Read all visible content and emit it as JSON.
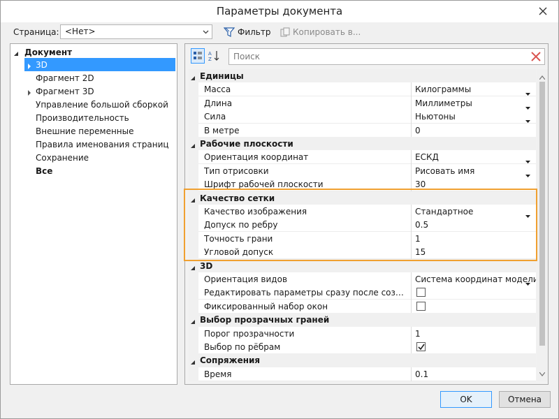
{
  "window": {
    "title": "Параметры документа"
  },
  "toolbar": {
    "page_label": "Страница:",
    "page_value": "<Нет>",
    "filter_label": "Фильтр",
    "copy_label": "Копировать в..."
  },
  "tree": {
    "root": "Документ",
    "items": [
      {
        "label": "3D",
        "selected": true,
        "expandable": true,
        "bold": false
      },
      {
        "label": "Фрагмент 2D",
        "selected": false,
        "expandable": false,
        "bold": false
      },
      {
        "label": "Фрагмент 3D",
        "selected": false,
        "expandable": true,
        "bold": false
      },
      {
        "label": "Управление большой сборкой",
        "selected": false,
        "expandable": false,
        "bold": false
      },
      {
        "label": "Производительность",
        "selected": false,
        "expandable": false,
        "bold": false
      },
      {
        "label": "Внешние переменные",
        "selected": false,
        "expandable": false,
        "bold": false
      },
      {
        "label": "Правила именования страниц",
        "selected": false,
        "expandable": false,
        "bold": false
      },
      {
        "label": "Сохранение",
        "selected": false,
        "expandable": false,
        "bold": false
      },
      {
        "label": "Все",
        "selected": false,
        "expandable": false,
        "bold": true
      }
    ]
  },
  "search": {
    "placeholder": "Поиск"
  },
  "grid": {
    "categories": [
      {
        "label": "Единицы",
        "rows": [
          {
            "name": "Масса",
            "value": "Килограммы",
            "type": "dropdown"
          },
          {
            "name": "Длина",
            "value": "Миллиметры",
            "type": "dropdown"
          },
          {
            "name": "Сила",
            "value": "Ньютоны",
            "type": "dropdown"
          },
          {
            "name": "В метре",
            "value": "0",
            "type": "text"
          }
        ]
      },
      {
        "label": "Рабочие плоскости",
        "rows": [
          {
            "name": "Ориентация координат",
            "value": "ЕСКД",
            "type": "dropdown"
          },
          {
            "name": "Тип отрисовки",
            "value": "Рисовать имя",
            "type": "dropdown"
          },
          {
            "name": "Шрифт рабочей плоскости",
            "value": "30",
            "type": "text"
          }
        ]
      },
      {
        "label": "Качество сетки",
        "rows": [
          {
            "name": "Качество изображения",
            "value": "Стандартное",
            "type": "dropdown"
          },
          {
            "name": "Допуск по ребру",
            "value": "0.5",
            "type": "text"
          },
          {
            "name": "Точность грани",
            "value": "1",
            "type": "text"
          },
          {
            "name": "Угловой допуск",
            "value": "15",
            "type": "text"
          }
        ]
      },
      {
        "label": "3D",
        "rows": [
          {
            "name": "Ориентация видов",
            "value": "Система координат модели",
            "type": "dropdown"
          },
          {
            "name": "Редактировать параметры сразу после создания (т...",
            "value": "",
            "type": "checkbox",
            "checked": false
          },
          {
            "name": "Фиксированный набор окон",
            "value": "",
            "type": "checkbox",
            "checked": false
          }
        ]
      },
      {
        "label": "Выбор прозрачных граней",
        "rows": [
          {
            "name": "Порог прозрачности",
            "value": "1",
            "type": "text"
          },
          {
            "name": "Выбор по рёбрам",
            "value": "",
            "type": "checkbox",
            "checked": true
          }
        ]
      },
      {
        "label": "Сопряжения",
        "rows": [
          {
            "name": "Время",
            "value": "0.1",
            "type": "text"
          }
        ]
      }
    ]
  },
  "buttons": {
    "ok": "OK",
    "cancel": "Отмена"
  },
  "colors": {
    "selection": "#3399ff",
    "highlight": "#f0a030",
    "close_x": "#d9534f"
  }
}
